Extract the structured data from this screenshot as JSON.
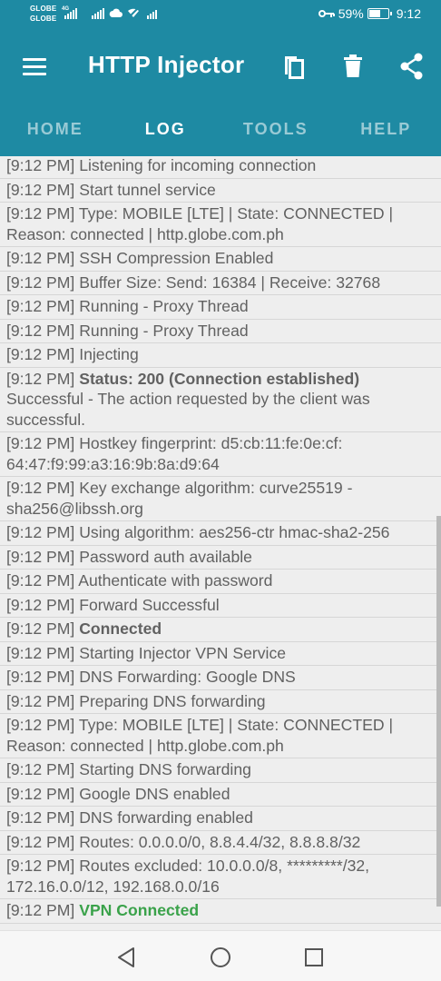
{
  "status_bar": {
    "carrier_1": "GLOBE",
    "carrier_1_tech": "4G",
    "carrier_2": "GLOBE",
    "battery_percent": "59%",
    "battery_level": 0.59,
    "time": "9:12"
  },
  "app_bar": {
    "title": "HTTP Injector"
  },
  "tabs": [
    {
      "label": "HOME",
      "active": false
    },
    {
      "label": "LOG",
      "active": true
    },
    {
      "label": "TOOLS",
      "active": false
    },
    {
      "label": "HELP",
      "active": false
    }
  ],
  "log": {
    "entries": [
      {
        "time": "[9:12 PM]",
        "text": "Listening for incoming connection"
      },
      {
        "time": "[9:12 PM]",
        "text": "Start tunnel service"
      },
      {
        "time": "[9:12 PM]",
        "text": "Type: MOBILE [LTE] | State: CONNECTED | Reason: connected | http.globe.com.ph"
      },
      {
        "time": "[9:12 PM]",
        "text": "SSH Compression Enabled"
      },
      {
        "time": "[9:12 PM]",
        "text": "Buffer Size: Send: 16384 | Receive: 32768"
      },
      {
        "time": "[9:12 PM]",
        "text": "Running - Proxy Thread"
      },
      {
        "time": "[9:12 PM]",
        "text": "Running - Proxy Thread"
      },
      {
        "time": "[9:12 PM]",
        "text": "Injecting"
      },
      {
        "time": "[9:12 PM]",
        "bold": "Status: 200 (Connection established)",
        "text": "Successful - The action requested by the client was successful."
      },
      {
        "time": "[9:12 PM]",
        "text": "Hostkey fingerprint: d5:cb:11:fe:0e:cf: 64:47:f9:99:a3:16:9b:8a:d9:64"
      },
      {
        "time": "[9:12 PM]",
        "text": "Key exchange algorithm: curve25519 -sha256@libssh.org"
      },
      {
        "time": "[9:12 PM]",
        "text": "Using algorithm: aes256-ctr hmac-sha2-256"
      },
      {
        "time": "[9:12 PM]",
        "text": "Password auth available"
      },
      {
        "time": "[9:12 PM]",
        "text": "Authenticate with password"
      },
      {
        "time": "[9:12 PM]",
        "text": "Forward Successful"
      },
      {
        "time": "[9:12 PM]",
        "bold": "Connected"
      },
      {
        "time": "[9:12 PM]",
        "text": "Starting Injector VPN Service"
      },
      {
        "time": "[9:12 PM]",
        "text": "DNS Forwarding: Google DNS"
      },
      {
        "time": "[9:12 PM]",
        "text": "Preparing DNS forwarding"
      },
      {
        "time": "[9:12 PM]",
        "text": "Type: MOBILE [LTE] | State: CONNECTED | Reason: connected | http.globe.com.ph"
      },
      {
        "time": "[9:12 PM]",
        "text": "Starting DNS forwarding"
      },
      {
        "time": "[9:12 PM]",
        "text": "Google DNS enabled"
      },
      {
        "time": "[9:12 PM]",
        "text": "DNS forwarding enabled"
      },
      {
        "time": "[9:12 PM]",
        "text": "Routes: 0.0.0.0/0, 8.8.4.4/32, 8.8.8.8/32"
      },
      {
        "time": "[9:12 PM]",
        "text": "Routes excluded: 10.0.0.0/8, *********/32, 172.16.0.0/12, 192.168.0.0/16"
      },
      {
        "time": "[9:12 PM]",
        "green": "VPN Connected"
      }
    ]
  },
  "colors": {
    "brand": "#1e8aa3",
    "log_background": "#eeeeee",
    "log_text": "#616161",
    "success_green": "#3aa24a"
  },
  "icons": {
    "menu": "hamburger-icon",
    "copy": "copy-icon",
    "delete": "trash-icon",
    "share": "share-icon",
    "nav_back": "back-triangle-icon",
    "nav_home": "home-circle-icon",
    "nav_recents": "recents-square-icon"
  }
}
